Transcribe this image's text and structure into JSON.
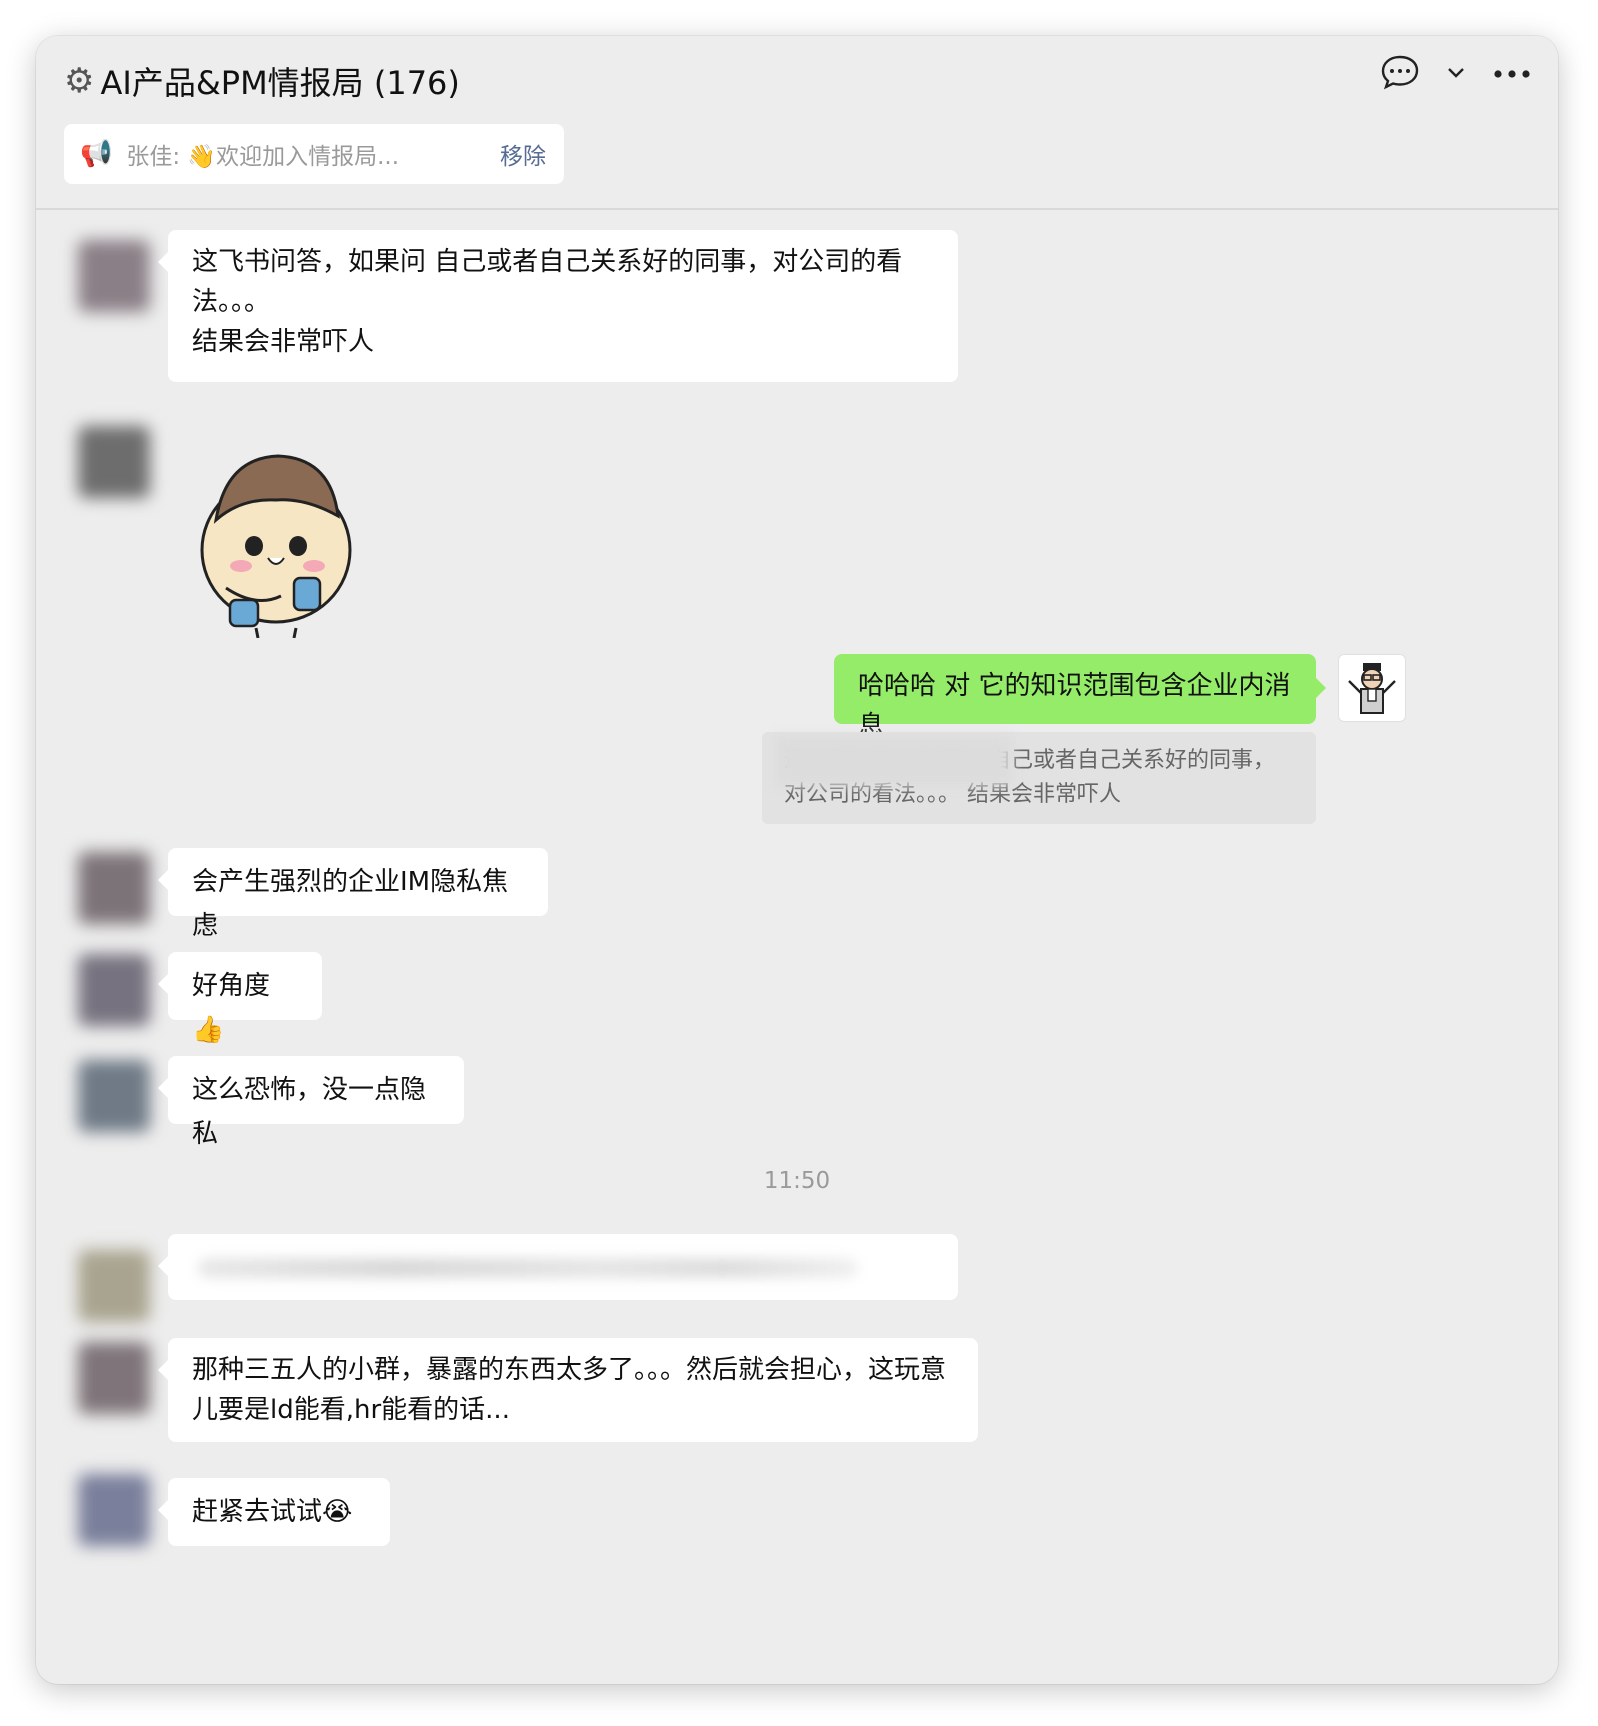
{
  "header": {
    "title": "AI产品&PM情报局 (176)",
    "icons": [
      "gear-icon",
      "chat-bubble-icon",
      "chevron-down-icon",
      "more-icon"
    ]
  },
  "notice": {
    "text": "张佳: 👋欢迎加入情报局...",
    "remove_label": "移除"
  },
  "messages": {
    "m1": "这飞书问答，如果问 自己或者自己关系好的同事，对公司的看法。。。\n结果会非常吓人",
    "m3_self": "哈哈哈 对 它的知识范围包含企业内消息",
    "m3_quote": "这飞书问答，如果问 自己或者自己关系好的同事，对公司的看法。。。 结果会非常吓人",
    "m4": "会产生强烈的企业IM隐私焦虑",
    "m5": "好角度👍",
    "m6": "这么恐怖，没一点隐私",
    "time": "11:50",
    "m8": "那种三五人的小群，暴露的东西太多了。。。然后就会担心，这玩意儿要是ld能看,hr能看的话...",
    "m9": "赶紧去试试😭"
  },
  "colors": {
    "background": "#ededed",
    "self_bubble": "#95ec69",
    "other_bubble": "#ffffff",
    "link": "#576b95"
  }
}
